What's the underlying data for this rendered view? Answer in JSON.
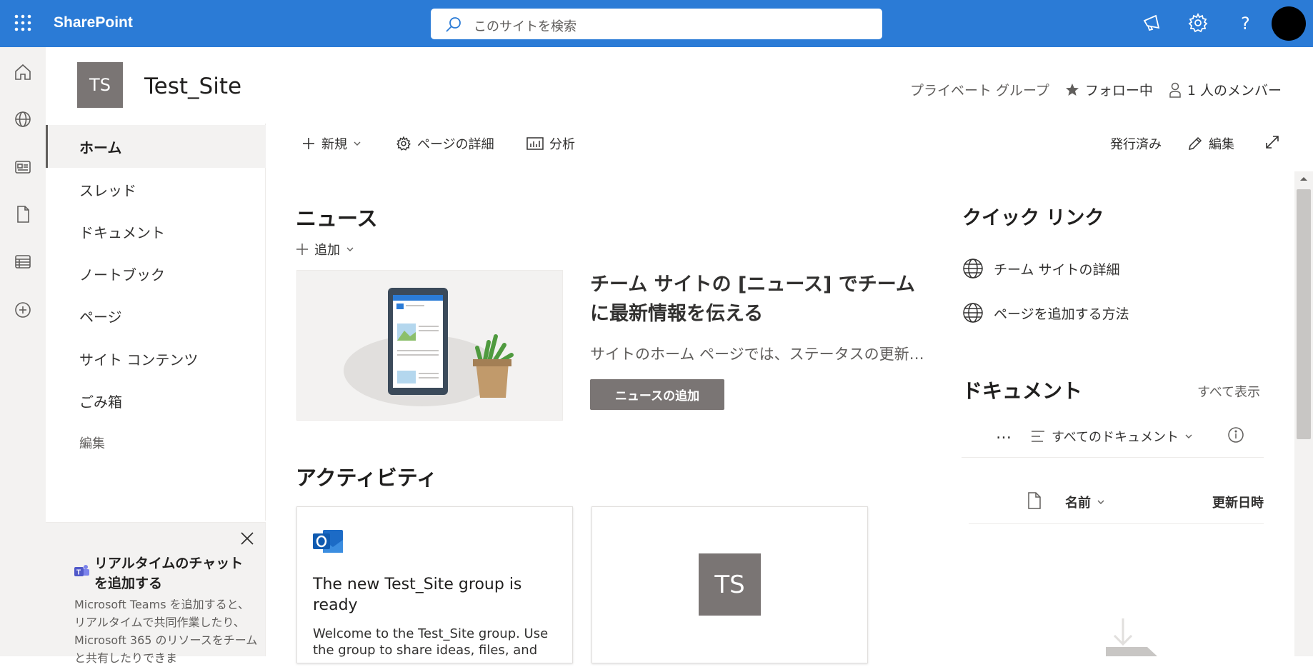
{
  "suitebar": {
    "brand": "SharePoint",
    "search_placeholder": "このサイトを検索",
    "icons": [
      "app-launcher-icon",
      "megaphone-icon",
      "gear-icon",
      "help-icon",
      "avatar"
    ]
  },
  "rail": {
    "icons": [
      "home-icon",
      "globe-icon",
      "news-icon",
      "document-icon",
      "list-icon",
      "add-circle-icon"
    ]
  },
  "site": {
    "logo_initials": "TS",
    "title": "Test_Site",
    "privacy": "プライベート グループ",
    "follow": "フォロー中",
    "members": "1 人のメンバー"
  },
  "leftnav": {
    "items": [
      {
        "label": "ホーム",
        "active": true
      },
      {
        "label": "スレッド"
      },
      {
        "label": "ドキュメント"
      },
      {
        "label": "ノートブック"
      },
      {
        "label": "ページ"
      },
      {
        "label": "サイト コンテンツ"
      },
      {
        "label": "ごみ箱"
      },
      {
        "label": "編集"
      }
    ]
  },
  "promo": {
    "title": "リアルタイムのチャットを追加する",
    "body": "Microsoft Teams を追加すると、リアルタイムで共同作業したり、Microsoft 365 のリソースをチームと共有したりできま"
  },
  "commandbar": {
    "new": "新規",
    "page_details": "ページの詳細",
    "analytics": "分析",
    "status": "発行済み",
    "edit": "編集"
  },
  "news": {
    "heading": "ニュース",
    "add": "追加",
    "headline": "チーム サイトの [ニュース] でチームに最新情報を伝える",
    "description": "サイトのホーム ページでは、ステータスの更新、出張報告、プロジェクトの詳細などを共有できます。",
    "button": "ニュースの追加"
  },
  "activity": {
    "heading": "アクティビティ",
    "card1_title": "The new Test_Site group is ready",
    "card1_body": "Welcome to the Test_Site group. Use the group to share ideas, files, and",
    "card2_initials": "TS"
  },
  "quicklinks": {
    "heading": "クイック リンク",
    "items": [
      "チーム サイトの詳細",
      "ページを追加する方法"
    ]
  },
  "documents": {
    "heading": "ドキュメント",
    "see_all": "すべて表示",
    "more": "…",
    "view": "すべてのドキュメント",
    "col_name": "名前",
    "col_modified": "更新日時"
  }
}
